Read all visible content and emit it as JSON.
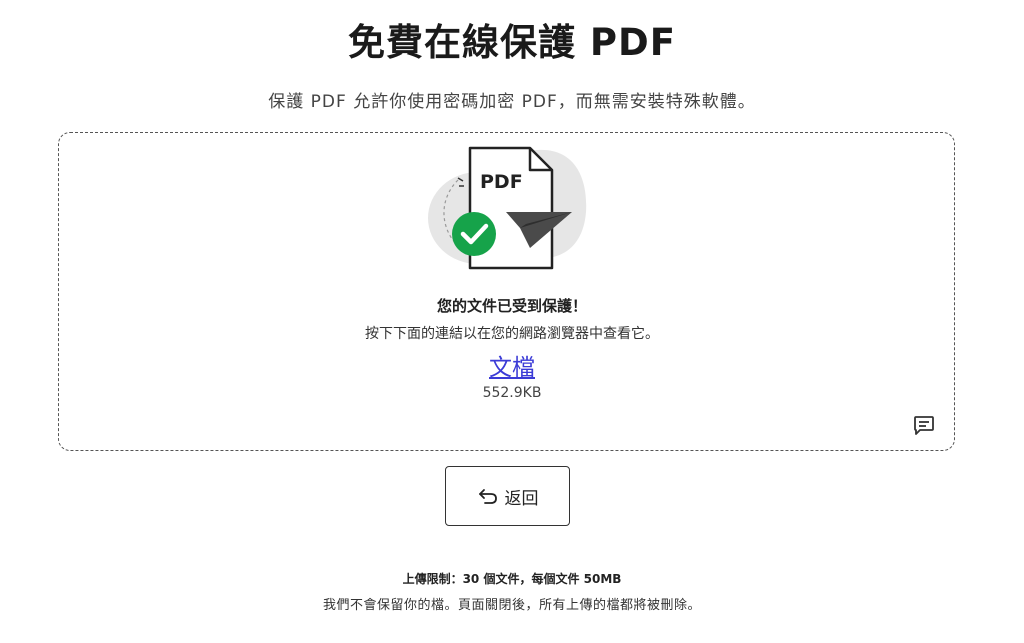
{
  "header": {
    "title": "免費在線保護 PDF",
    "subtitle": "保護 PDF 允許你使用密碼加密 PDF，而無需安裝特殊軟體。"
  },
  "result": {
    "illustration_label": "PDF",
    "success_title": "您的文件已受到保護！",
    "success_desc": "按下下面的連結以在您的網路瀏覽器中查看它。",
    "file_link_label": "文檔",
    "file_size": "552.9KB"
  },
  "actions": {
    "back_label": "返回"
  },
  "footer": {
    "limit_text": "上傳限制：30 個文件，每個文件 50MB",
    "privacy_text": "我們不會保留你的檔。頁面關閉後，所有上傳的檔都將被刪除。"
  },
  "colors": {
    "success_green": "#16a34a",
    "link_blue": "#3b3bd6",
    "illustration_bg": "#e6e6e6"
  },
  "icons": {
    "success": "check-circle-icon",
    "send": "paper-plane-icon",
    "back": "undo-arrow-icon",
    "feedback": "comment-icon"
  }
}
